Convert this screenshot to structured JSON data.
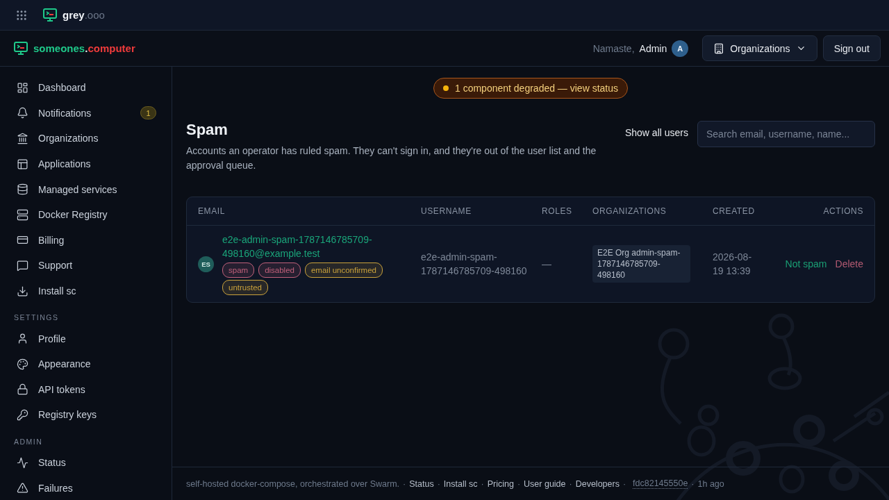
{
  "topbar": {
    "brand": "grey",
    "brand_suffix": ".ooo"
  },
  "header": {
    "brand": "someones",
    "brand_dot": ".",
    "brand_suffix": "computer",
    "greeting": "Namaste,",
    "user": "Admin",
    "avatar": "A",
    "org_button": "Organizations",
    "signout": "Sign out"
  },
  "sidebar": {
    "sections": [
      {
        "items": [
          {
            "label": "Dashboard"
          },
          {
            "label": "Notifications",
            "badge": "1"
          },
          {
            "label": "Organizations"
          },
          {
            "label": "Applications"
          },
          {
            "label": "Managed services"
          },
          {
            "label": "Docker Registry"
          },
          {
            "label": "Billing"
          },
          {
            "label": "Support"
          },
          {
            "label": "Install sc"
          }
        ]
      },
      {
        "title": "SETTINGS",
        "items": [
          {
            "label": "Profile"
          },
          {
            "label": "Appearance"
          },
          {
            "label": "API tokens"
          },
          {
            "label": "Registry keys"
          }
        ]
      },
      {
        "title": "ADMIN",
        "items": [
          {
            "label": "Status"
          },
          {
            "label": "Failures"
          }
        ]
      }
    ]
  },
  "banner": {
    "text": "1 component degraded — view status"
  },
  "page": {
    "title": "Spam",
    "description": "Accounts an operator has ruled spam. They can't sign in, and they're out of the user list and the approval queue.",
    "toggle_label": "Show all users",
    "search": {
      "placeholder": "Search email, username, name..."
    }
  },
  "table": {
    "columns": [
      "EMAIL",
      "USERNAME",
      "ROLES",
      "ORGANIZATIONS",
      "CREATED",
      "ACTIONS"
    ],
    "rows": [
      {
        "avatar": "ES",
        "email": "e2e-admin-spam-1787146785709-498160@example.test",
        "tags": [
          {
            "label": "spam",
            "color": "#c0607a"
          },
          {
            "label": "disabled",
            "color": "#c0607a"
          },
          {
            "label": "email unconfirmed",
            "color": "#c9a13b"
          },
          {
            "label": "untrusted",
            "color": "#c9a13b"
          }
        ],
        "username": "e2e-admin-spam-1787146785709-498160",
        "roles": "—",
        "organization": "E2E Org admin-spam-1787146785709-498160",
        "created": "2026-08-19 13:39",
        "actions": [
          {
            "label": "Not spam",
            "kind": "confirm"
          },
          {
            "label": "Delete",
            "kind": "danger"
          }
        ]
      }
    ]
  },
  "footer": [
    {
      "text": "self-hosted docker-compose, orchestrated over Swarm.",
      "kind": "text"
    },
    {
      "text": "·",
      "kind": "sep"
    },
    {
      "text": "Status",
      "kind": "link"
    },
    {
      "text": "·",
      "kind": "sep"
    },
    {
      "text": "Install sc",
      "kind": "link"
    },
    {
      "text": "·",
      "kind": "sep"
    },
    {
      "text": "Pricing",
      "kind": "link"
    },
    {
      "text": "·",
      "kind": "sep"
    },
    {
      "text": "User guide",
      "kind": "link"
    },
    {
      "text": "·",
      "kind": "sep"
    },
    {
      "text": "Developers",
      "kind": "link"
    },
    {
      "text": "·",
      "kind": "sep"
    },
    {
      "text": "fdc82145550e",
      "kind": "hash"
    },
    {
      "text": "·",
      "kind": "sep"
    },
    {
      "text": "1h ago",
      "kind": "text"
    }
  ]
}
